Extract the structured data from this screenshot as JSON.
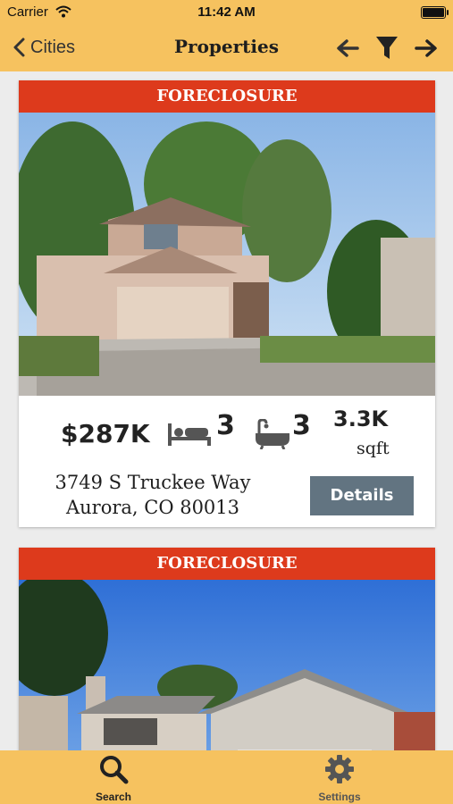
{
  "status_bar": {
    "carrier": "Carrier",
    "time": "11:42 AM"
  },
  "navbar": {
    "back_label": "Cities",
    "title": "Properties",
    "icons": [
      "arrow-left-icon",
      "filter-icon",
      "arrow-right-icon"
    ]
  },
  "colors": {
    "accent": "#f6c25f",
    "banner": "#dd3a1c",
    "details_button": "#627481"
  },
  "listings": [
    {
      "banner": "FORECLOSURE",
      "price": "$287K",
      "beds": "3",
      "baths": "3",
      "sqft": "3.3K",
      "sqft_unit": "sqft",
      "address_line1": "3749 S Truckee Way",
      "address_line2": "Aurora, CO 80013",
      "details_label": "Details"
    },
    {
      "banner": "FORECLOSURE"
    }
  ],
  "tabbar": {
    "items": [
      {
        "label": "Search",
        "icon": "search-icon",
        "active": true
      },
      {
        "label": "Settings",
        "icon": "gear-icon",
        "active": false
      }
    ]
  }
}
